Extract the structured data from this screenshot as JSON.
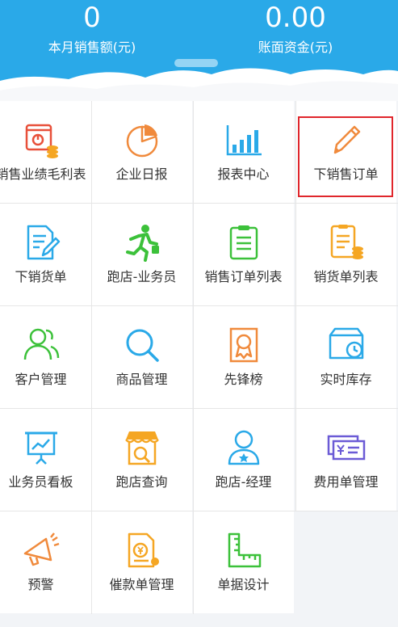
{
  "header": {
    "sales": {
      "value": "0",
      "label": "本月销售额(元)"
    },
    "funds": {
      "value": "0.00",
      "label": "账面资金(元)"
    }
  },
  "grid": {
    "items": [
      {
        "label": "销售业绩毛利表",
        "icon": "sales-profit-report-icon"
      },
      {
        "label": "企业日报",
        "icon": "pie-chart-icon"
      },
      {
        "label": "报表中心",
        "icon": "bar-chart-icon"
      },
      {
        "label": "下销售订单",
        "icon": "pencil-icon"
      },
      {
        "label": "下销货单",
        "icon": "document-edit-icon"
      },
      {
        "label": "跑店-业务员",
        "icon": "running-man-icon"
      },
      {
        "label": "销售订单列表",
        "icon": "clipboard-list-icon"
      },
      {
        "label": "销货单列表",
        "icon": "list-coins-icon"
      },
      {
        "label": "客户管理",
        "icon": "users-icon"
      },
      {
        "label": "商品管理",
        "icon": "search-icon"
      },
      {
        "label": "先锋榜",
        "icon": "award-ribbon-icon"
      },
      {
        "label": "实时库存",
        "icon": "inventory-clock-icon"
      },
      {
        "label": "业务员看板",
        "icon": "presentation-board-icon"
      },
      {
        "label": "跑店查询",
        "icon": "store-search-icon"
      },
      {
        "label": "跑店-经理",
        "icon": "manager-user-icon"
      },
      {
        "label": "费用单管理",
        "icon": "expense-bill-icon"
      },
      {
        "label": "预警",
        "icon": "megaphone-icon"
      },
      {
        "label": "催款单管理",
        "icon": "payment-reminder-icon"
      },
      {
        "label": "单据设计",
        "icon": "ruler-icon"
      }
    ]
  },
  "colors": {
    "header_bg": "#2aa9e8",
    "orange": "#f08a3c",
    "green": "#3cc13a",
    "blue": "#2aa9e8",
    "purple": "#6b5bd6",
    "highlight": "#e0262c"
  }
}
